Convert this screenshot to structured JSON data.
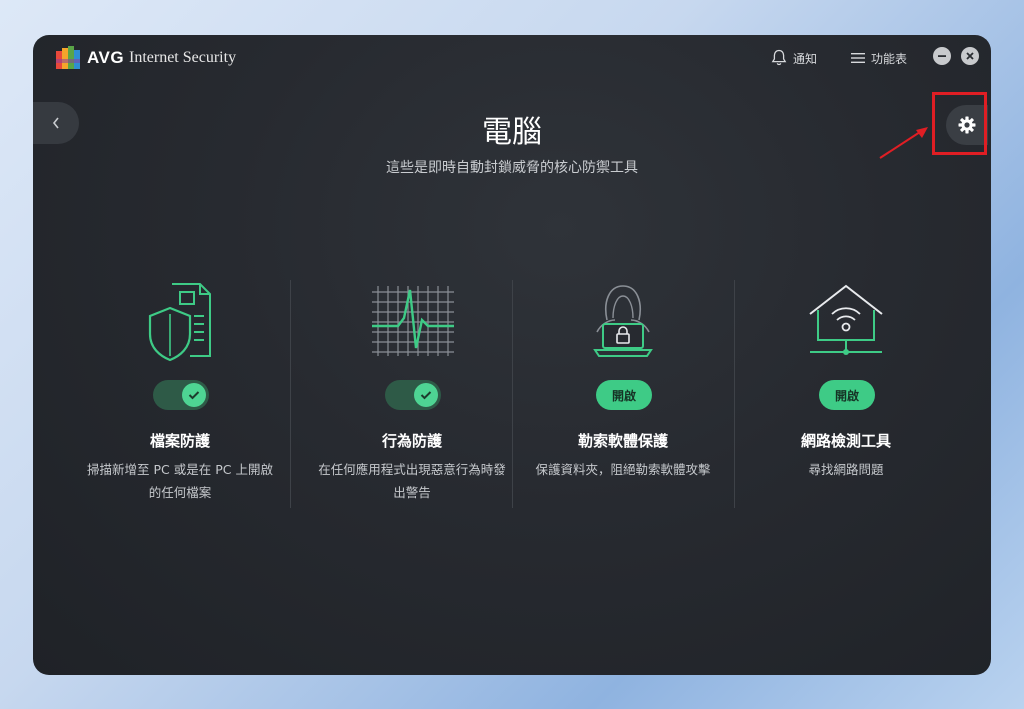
{
  "app": {
    "brand": "AVG",
    "product": "Internet Security"
  },
  "titlebar": {
    "notify_label": "通知",
    "menu_label": "功能表"
  },
  "page": {
    "title": "電腦",
    "subtitle": "這些是即時自動封鎖威脅的核心防禦工具"
  },
  "cards": [
    {
      "icon": "file-shield-icon",
      "state": "on",
      "title": "檔案防護",
      "desc": "掃描新增至 PC 或是在 PC 上開啟的任何檔案"
    },
    {
      "icon": "behavior-graph-icon",
      "state": "on",
      "title": "行為防護",
      "desc": "在任何應用程式出現惡意行為時發出警告"
    },
    {
      "icon": "ransomware-laptop-icon",
      "state": "off",
      "button_label": "開啟",
      "title": "勒索軟體保護",
      "desc": "保護資料夾，阻絕勒索軟體攻擊"
    },
    {
      "icon": "network-house-icon",
      "state": "off",
      "button_label": "開啟",
      "title": "網路檢測工具",
      "desc": "尋找網路問題"
    }
  ],
  "colors": {
    "accent_green": "#3ecb86",
    "highlight_red": "#e01e24",
    "window_bg": "#272a30"
  }
}
